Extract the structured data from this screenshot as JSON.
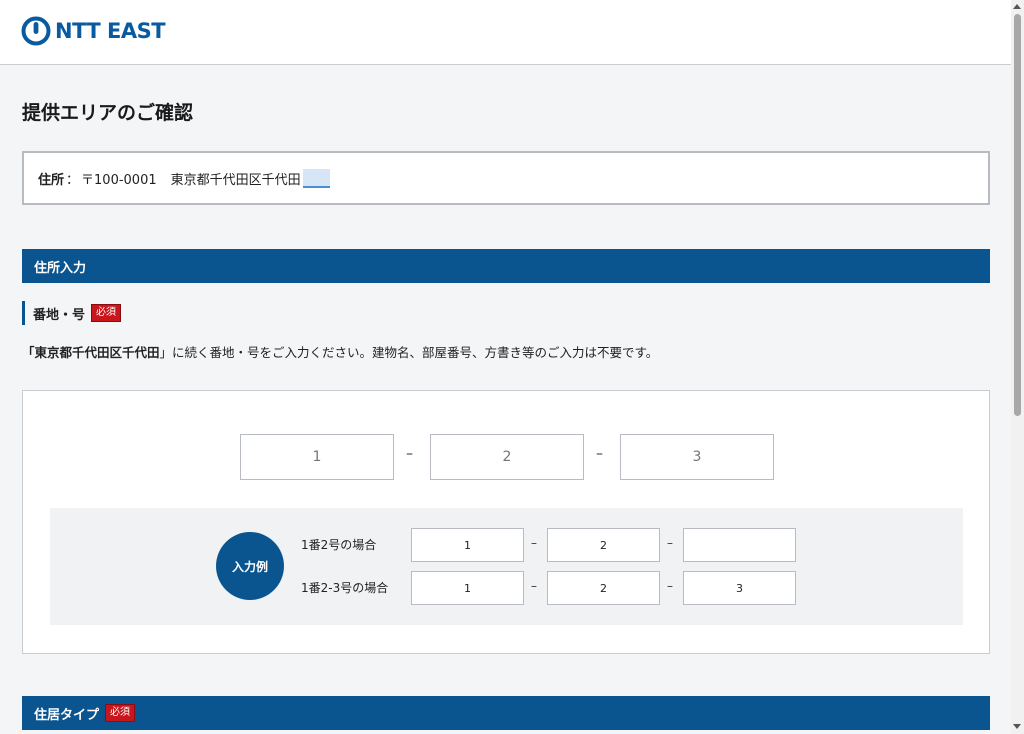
{
  "header": {
    "logo_text": "NTT EAST",
    "logo_icon": "ntt-logo-mark"
  },
  "page": {
    "title": "提供エリアのご確認"
  },
  "address": {
    "label": "住所",
    "separator": "：",
    "postal": "〒100-0001",
    "city": "東京都千代田区千代田"
  },
  "section_address": {
    "title": "住所入力"
  },
  "banchi": {
    "label": "番地・号",
    "required_badge": "必須",
    "instruction_prefix": "「",
    "instruction_area": "東京都千代田区千代田",
    "instruction_suffix": "」に続く番地・号をご入力ください。建物名、部屋番号、方書き等のご入力は不要です。",
    "inputs": [
      {
        "placeholder": "1",
        "value": ""
      },
      {
        "placeholder": "2",
        "value": ""
      },
      {
        "placeholder": "3",
        "value": ""
      }
    ],
    "dash": "–"
  },
  "example": {
    "badge": "入力例",
    "rows": [
      {
        "label": "1番2号の場合",
        "values": [
          "1",
          "2",
          ""
        ]
      },
      {
        "label": "1番2-3号の場合",
        "values": [
          "1",
          "2",
          "3"
        ]
      }
    ],
    "dash": "–"
  },
  "section_residence": {
    "title": "住居タイプ",
    "required_badge": "必須"
  },
  "colors": {
    "brand_blue": "#0a558f",
    "required_red": "#c8161d",
    "background": "#f4f5f7"
  }
}
